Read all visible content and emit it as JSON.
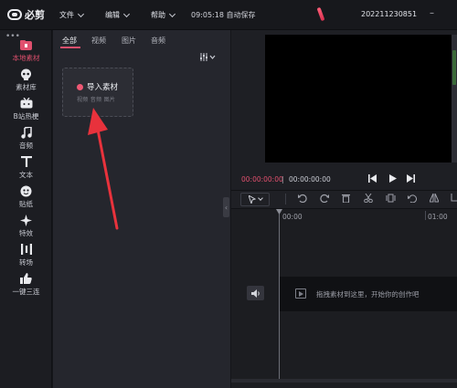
{
  "titlebar": {
    "logo_text": "必剪",
    "menus": [
      "文件",
      "编辑",
      "帮助"
    ],
    "save_status": "09:05:18 自动保存",
    "project_name": "202211230851"
  },
  "tools": {
    "more_dots": "•••",
    "items": [
      {
        "label": "本地素材",
        "icon": "folder-icon"
      },
      {
        "label": "素材库",
        "icon": "skull-icon"
      },
      {
        "label": "B站热梗",
        "icon": "tv-icon"
      },
      {
        "label": "音频",
        "icon": "music-note-icon"
      },
      {
        "label": "文本",
        "icon": "text-icon"
      },
      {
        "label": "贴纸",
        "icon": "sticker-icon"
      },
      {
        "label": "特效",
        "icon": "sparkle-icon"
      },
      {
        "label": "转场",
        "icon": "transition-icon"
      },
      {
        "label": "一键三连",
        "icon": "thumbs-up-icon"
      }
    ],
    "active_index": 0
  },
  "media": {
    "tabs": [
      "全部",
      "视频",
      "图片",
      "音频"
    ],
    "active_tab": 0,
    "import_title": "导入素材",
    "import_sub": "视频 音频 图片"
  },
  "player": {
    "current_time": "00:00:00:00",
    "separator": "|",
    "total_time": "00:00:00:00"
  },
  "timeline": {
    "ruler_start": "00:00",
    "ruler_next": "01:00",
    "drop_hint": "拖拽素材到这里，开始你的创作吧"
  },
  "colors": {
    "accent": "#e0506e",
    "annotation_arrow": "#e8323c"
  }
}
